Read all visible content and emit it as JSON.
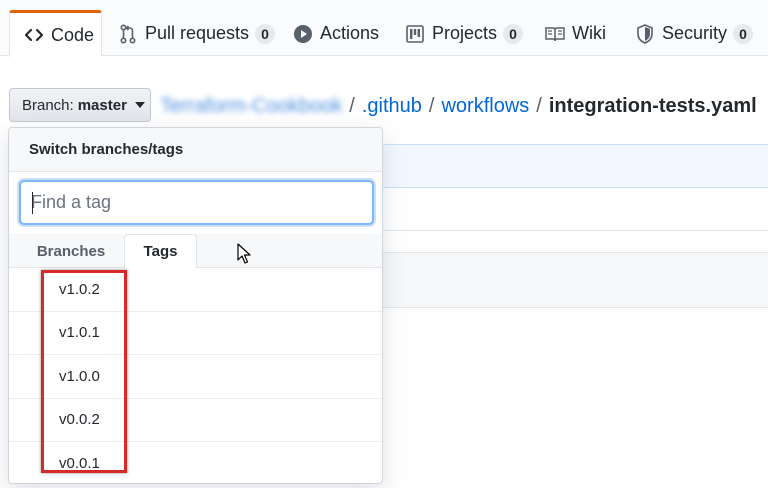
{
  "nav": {
    "tabs": [
      {
        "label": "Code",
        "icon": "code-icon"
      },
      {
        "label": "Pull requests",
        "icon": "pull-request-icon",
        "count": "0"
      },
      {
        "label": "Actions",
        "icon": "play-icon"
      },
      {
        "label": "Projects",
        "icon": "project-icon",
        "count": "0"
      },
      {
        "label": "Wiki",
        "icon": "book-icon"
      },
      {
        "label": "Security",
        "icon": "shield-icon",
        "count": "0"
      }
    ]
  },
  "branch_button": {
    "prefix": "Branch:",
    "value": "master"
  },
  "breadcrumb": {
    "repo": "Terraform-Cookbook",
    "separator": "/",
    "folder1": ".github",
    "folder2": "workflows",
    "file": "integration-tests.yaml"
  },
  "dropdown": {
    "header": "Switch branches/tags",
    "filter_placeholder": "Find a tag",
    "tabs": {
      "branches": "Branches",
      "tags": "Tags"
    },
    "tags": [
      "v1.0.2",
      "v1.0.1",
      "v1.0.0",
      "v0.0.2",
      "v0.0.1"
    ]
  },
  "colors": {
    "accent_tab": "#e36209",
    "link": "#0366d6",
    "highlight": "#d42a2a"
  }
}
